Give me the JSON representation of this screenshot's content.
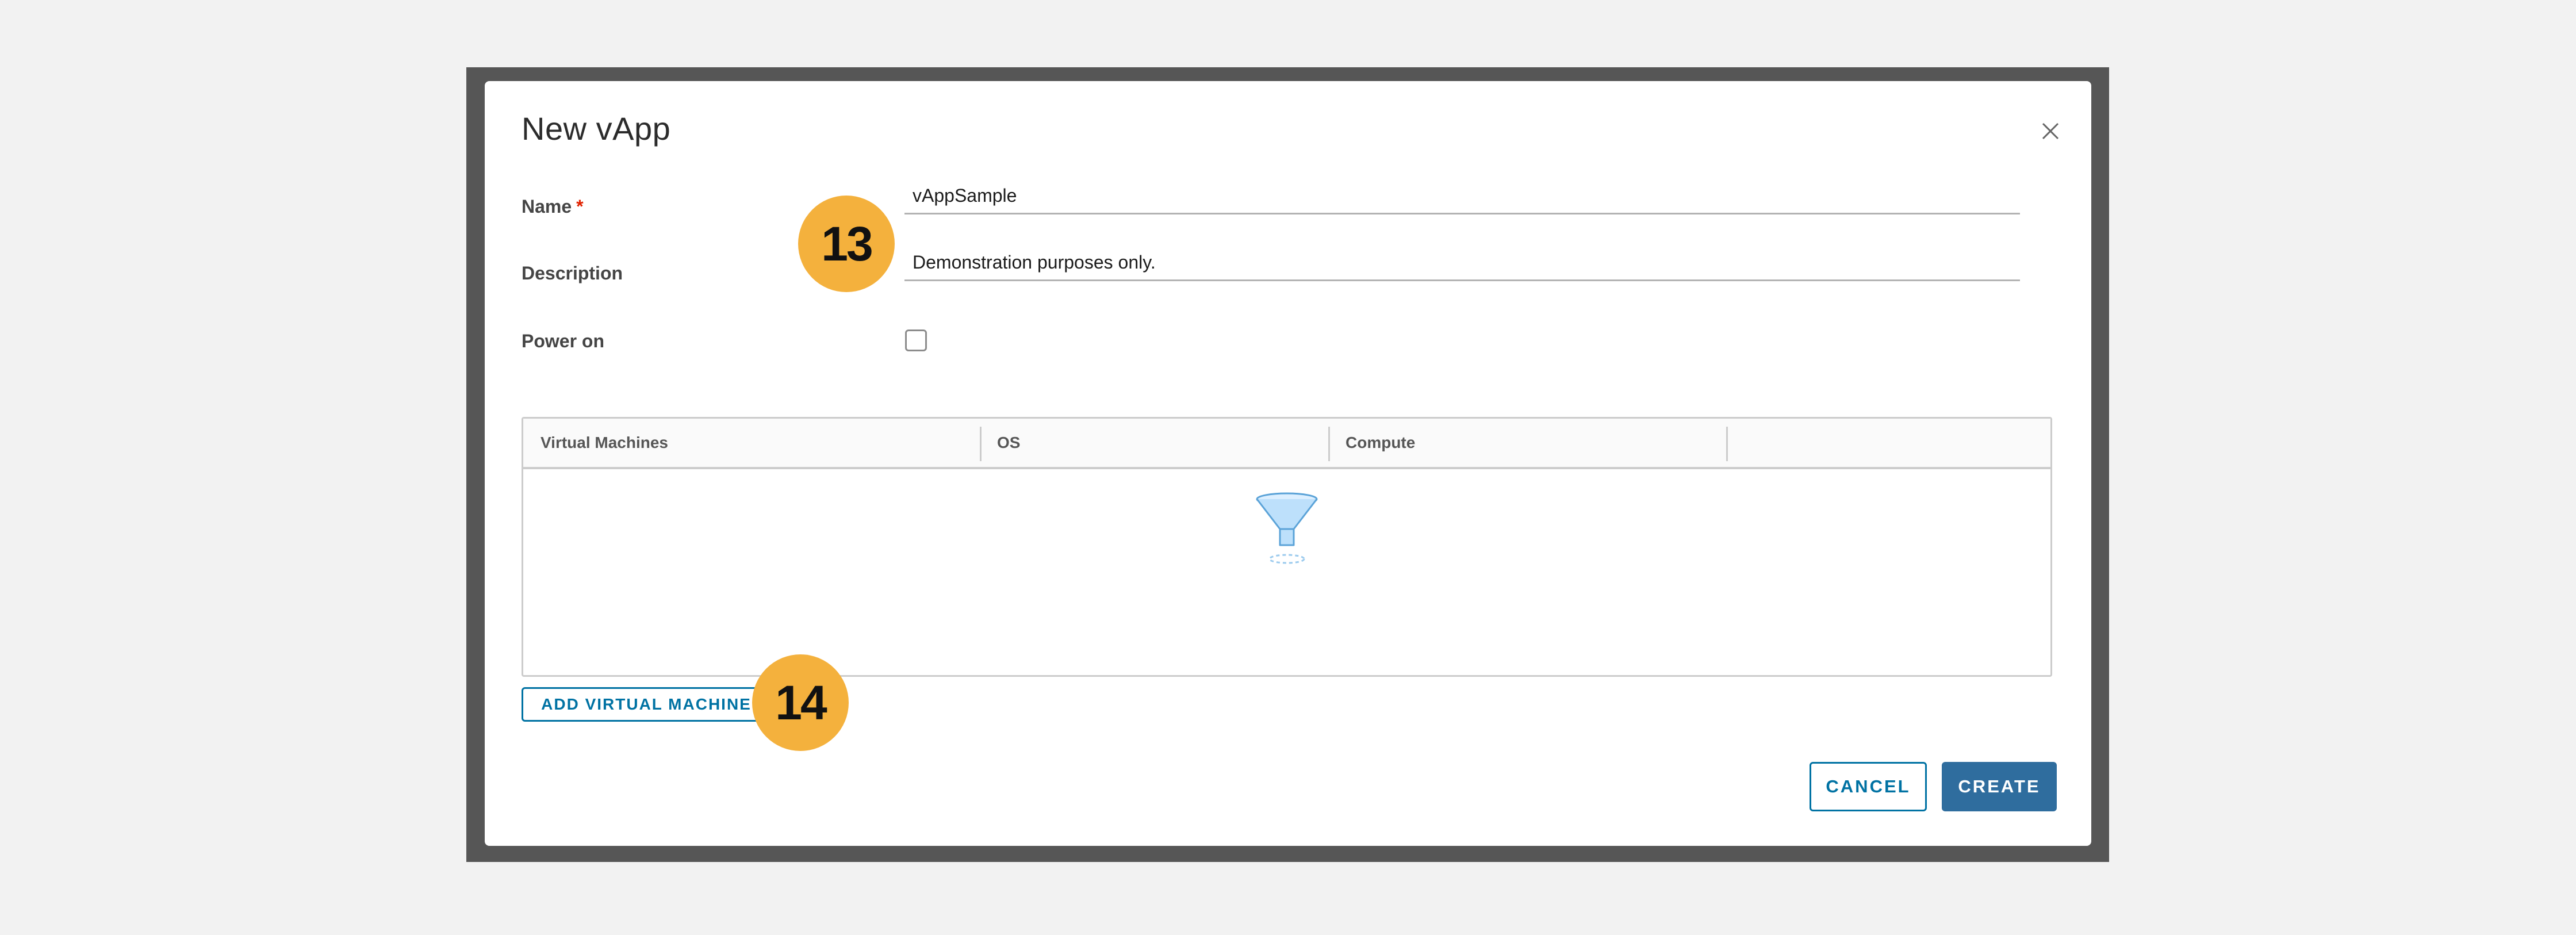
{
  "dialog": {
    "title": "New vApp",
    "close_icon": "close-icon"
  },
  "form": {
    "name_label": "Name",
    "required_marker": "*",
    "name_value": "vAppSample",
    "description_label": "Description",
    "description_value": "Demonstration purposes only.",
    "power_on_label": "Power on",
    "power_on_checked": false
  },
  "vm_grid": {
    "columns": [
      "Virtual Machines",
      "OS",
      "Compute",
      ""
    ],
    "rows": [],
    "empty_icon": "funnel-icon"
  },
  "buttons": {
    "add_vm": "ADD VIRTUAL MACHINE",
    "cancel": "CANCEL",
    "create": "CREATE"
  },
  "callouts": {
    "step_13": "13",
    "step_14": "14"
  },
  "colors": {
    "accent": "#0072a3",
    "primary_button": "#2f6d9e",
    "callout": "#f4b13d",
    "required": "#e12200"
  }
}
